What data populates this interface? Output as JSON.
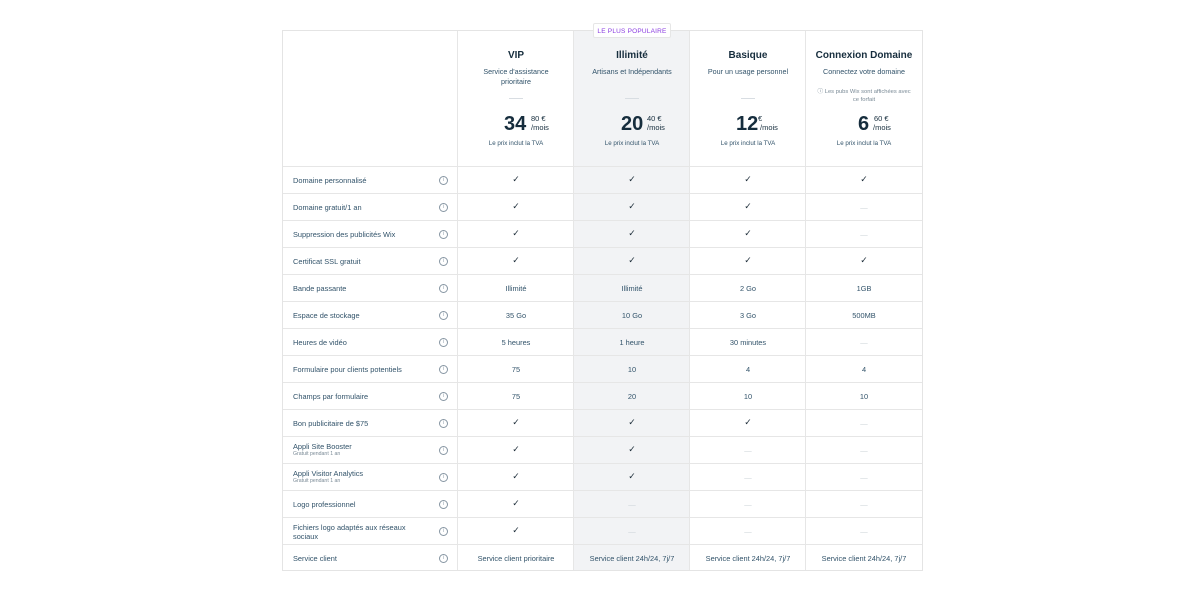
{
  "badge": "LE PLUS POPULAIRE",
  "plans": [
    {
      "name": "VIP",
      "desc": "Service d'assistance prioritaire",
      "note": "",
      "price_int": "34",
      "price_cents": "80 €",
      "price_per": "/mois",
      "tva": "Le prix inclut la TVA"
    },
    {
      "name": "Illimité",
      "desc": "Artisans et Indépendants",
      "note": "",
      "price_int": "20",
      "price_cents": "40 €",
      "price_per": "/mois",
      "tva": "Le prix inclut la TVA"
    },
    {
      "name": "Basique",
      "desc": "Pour un usage personnel",
      "note": "",
      "price_int": "12",
      "price_cents": "€",
      "price_per": "/mois",
      "tva": "Le prix inclut la TVA"
    },
    {
      "name": "Connexion Domaine",
      "desc": "Connectez votre domaine",
      "note": "ⓘ Les pubs Wix sont affichées avec ce forfait",
      "price_int": "6",
      "price_cents": "60 €",
      "price_per": "/mois",
      "tva": "Le prix inclut la TVA"
    }
  ],
  "info_glyph": "i",
  "check_glyph": "✓",
  "dash_glyph": "—",
  "features": [
    {
      "label": "Domaine personnalisé",
      "sub": "",
      "values": [
        "✓",
        "✓",
        "✓",
        "✓"
      ]
    },
    {
      "label": "Domaine gratuit/1 an",
      "sub": "",
      "values": [
        "✓",
        "✓",
        "✓",
        "—"
      ]
    },
    {
      "label": "Suppression des publicités Wix",
      "sub": "",
      "values": [
        "✓",
        "✓",
        "✓",
        "—"
      ]
    },
    {
      "label": "Certificat SSL gratuit",
      "sub": "",
      "values": [
        "✓",
        "✓",
        "✓",
        "✓"
      ]
    },
    {
      "label": "Bande passante",
      "sub": "",
      "values": [
        "Illimité",
        "Illimité",
        "2 Go",
        "1GB"
      ]
    },
    {
      "label": "Espace de stockage",
      "sub": "",
      "values": [
        "35 Go",
        "10 Go",
        "3 Go",
        "500MB"
      ]
    },
    {
      "label": "Heures de vidéo",
      "sub": "",
      "values": [
        "5 heures",
        "1 heure",
        "30 minutes",
        "—"
      ]
    },
    {
      "label": "Formulaire pour clients potentiels",
      "sub": "",
      "values": [
        "75",
        "10",
        "4",
        "4"
      ]
    },
    {
      "label": "Champs par formulaire",
      "sub": "",
      "values": [
        "75",
        "20",
        "10",
        "10"
      ]
    },
    {
      "label": "Bon publicitaire de $75",
      "sub": "",
      "values": [
        "✓",
        "✓",
        "✓",
        "—"
      ]
    },
    {
      "label": "Appli Site Booster",
      "sub": "Gratuit pendant 1 an",
      "values": [
        "✓",
        "✓",
        "—",
        "—"
      ]
    },
    {
      "label": "Appli Visitor Analytics",
      "sub": "Gratuit pendant 1 an",
      "values": [
        "✓",
        "✓",
        "—",
        "—"
      ]
    },
    {
      "label": "Logo professionnel",
      "sub": "",
      "values": [
        "✓",
        "—",
        "—",
        "—"
      ]
    },
    {
      "label": "Fichiers logo adaptés aux réseaux sociaux",
      "sub": "",
      "values": [
        "✓",
        "—",
        "—",
        "—"
      ]
    },
    {
      "label": "Service client",
      "sub": "",
      "values": [
        "Service client prioritaire",
        "Service client 24h/24, 7j/7",
        "Service client 24h/24, 7j/7",
        "Service client 24h/24, 7j/7"
      ]
    }
  ]
}
